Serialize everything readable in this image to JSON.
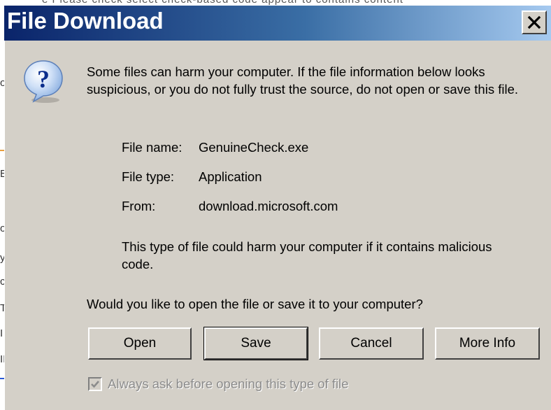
{
  "background": {
    "top_fragment": "e Please check select check-based code appear to contains content",
    "left_fragments": [
      "o,",
      "E",
      "o",
      "y",
      "c",
      "T",
      "I",
      "II"
    ]
  },
  "dialog": {
    "title": "File Download",
    "close_label": "×",
    "icon": "question-icon",
    "warning": "Some files can harm your computer. If the file information below looks suspicious, or you do not fully trust the source, do not open or save this file.",
    "file_info": [
      {
        "label": "File name:",
        "value": "GenuineCheck.exe"
      },
      {
        "label": "File type:",
        "value": "Application"
      },
      {
        "label": "From:",
        "value": "download.microsoft.com"
      }
    ],
    "harm_notice": "This type of file could harm your computer if it contains malicious code.",
    "question": "Would you like to open the file or save it to your computer?",
    "buttons": {
      "open": "Open",
      "save": "Save",
      "cancel": "Cancel",
      "more_info": "More Info"
    },
    "always_ask": {
      "label": "Always ask before opening this type of file",
      "checked": true,
      "enabled": false
    }
  },
  "colors": {
    "title_gradient_start": "#0a246a",
    "title_gradient_end": "#a6caf0",
    "dialog_face": "#d4d0c8",
    "disabled_text": "#8c8c8c"
  }
}
